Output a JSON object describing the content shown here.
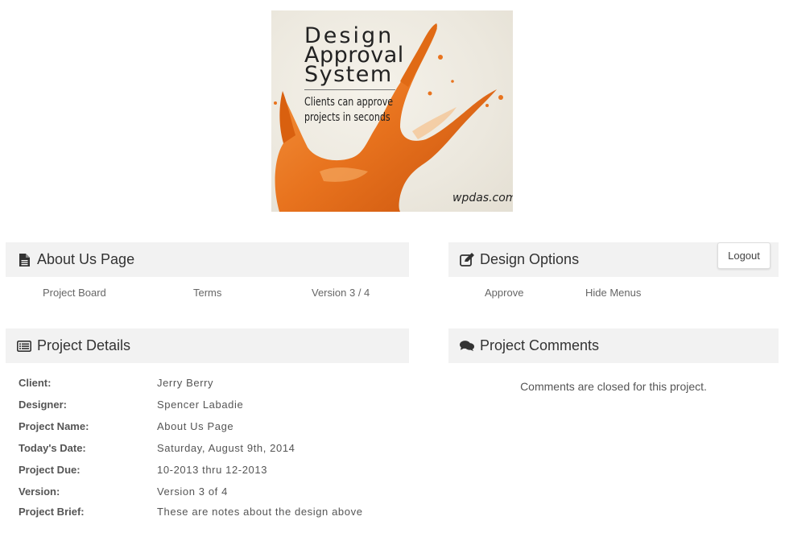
{
  "banner": {
    "title_line1": "Design",
    "title_line2": "Approval",
    "title_line3": "System",
    "subtitle_line1": "Clients can approve",
    "subtitle_line2": "projects in seconds",
    "site": "wpdas.com",
    "splash_color": "#e8731e"
  },
  "about_panel": {
    "title": "About Us Page",
    "icon": "file-icon",
    "links": [
      "Project Board",
      "Terms",
      "Version 3 / 4"
    ]
  },
  "design_panel": {
    "title": "Design Options",
    "icon": "edit-icon",
    "logout_label": "Logout",
    "links": [
      "Approve",
      "Hide Menus"
    ]
  },
  "details_panel": {
    "title": "Project Details",
    "icon": "list-icon",
    "rows": [
      {
        "label": "Client:",
        "value": "Jerry Berry"
      },
      {
        "label": "Designer:",
        "value": "Spencer Labadie"
      },
      {
        "label": "Project Name:",
        "value": "About Us Page"
      },
      {
        "label": "Today's Date:",
        "value": "Saturday, August 9th, 2014"
      },
      {
        "label": "Project Due:",
        "value": "10-2013 thru 12-2013"
      },
      {
        "label": "Version:",
        "value": "Version 3 of 4"
      },
      {
        "label": "Project Brief:",
        "value": "These are notes about the design above"
      }
    ]
  },
  "comments_panel": {
    "title": "Project Comments",
    "icon": "comments-icon",
    "message": "Comments are closed for this project."
  }
}
